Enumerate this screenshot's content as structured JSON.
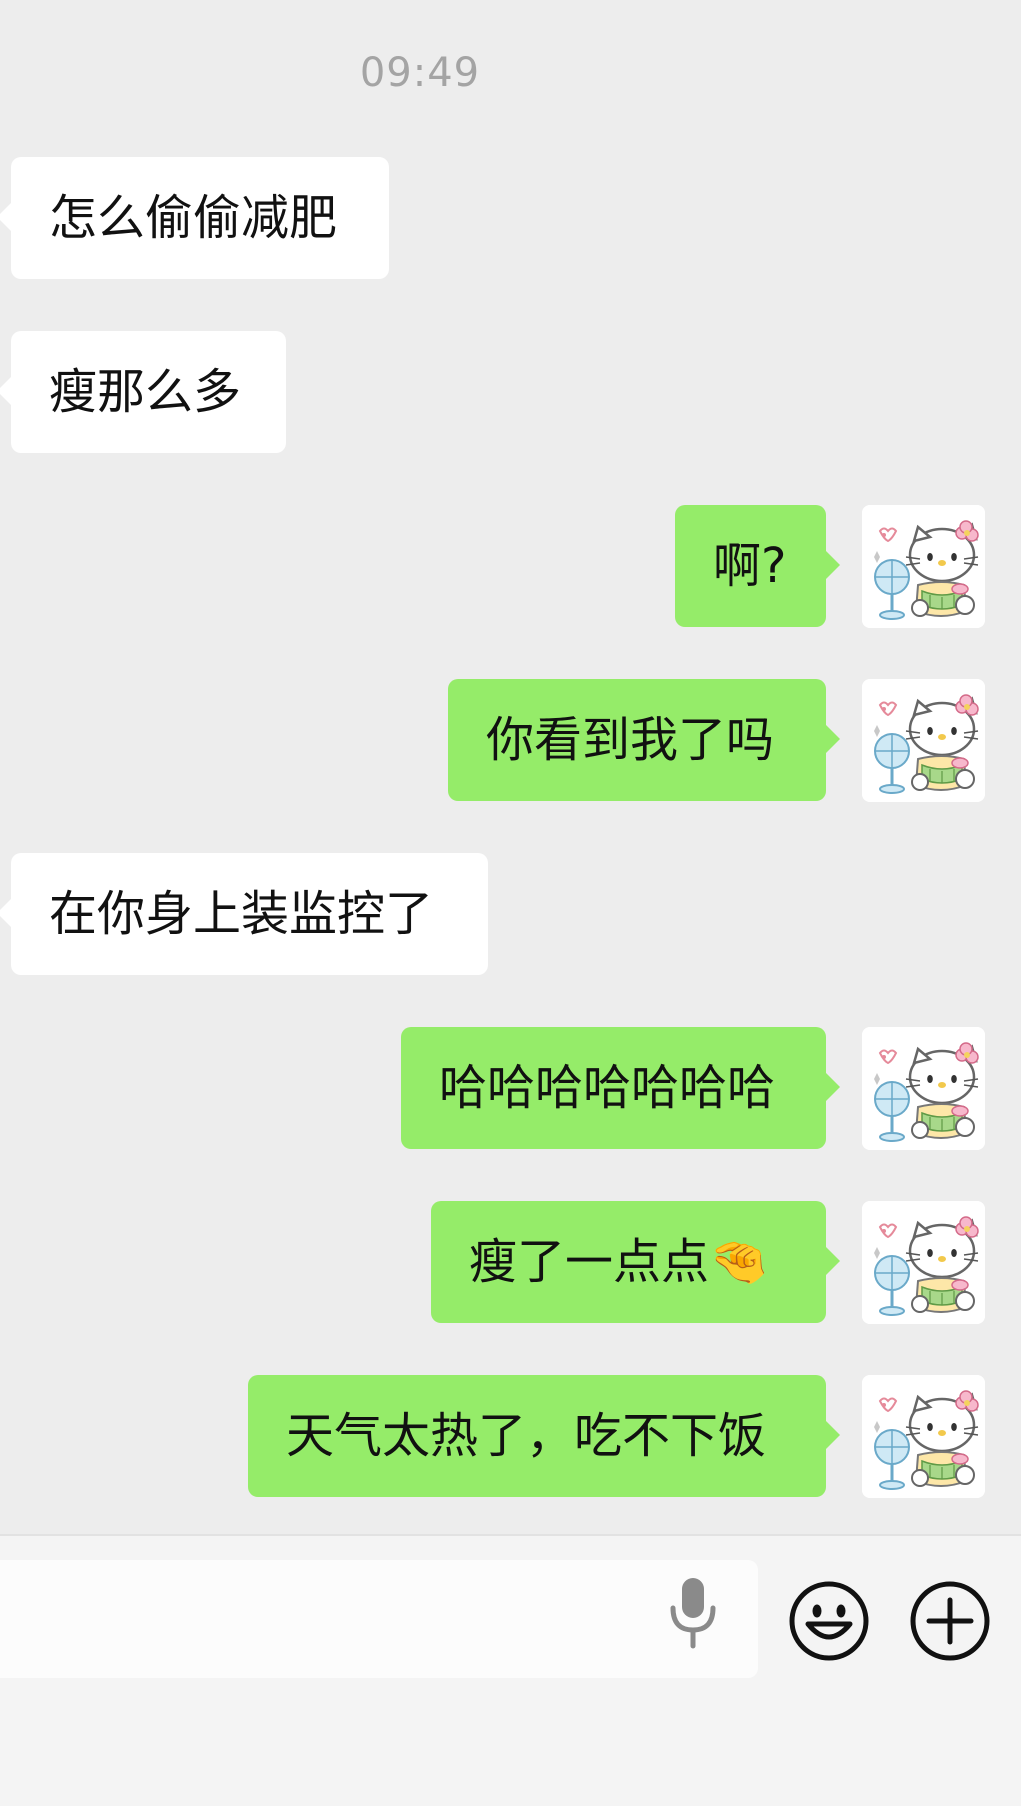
{
  "timestamp": "09:49",
  "messages": [
    {
      "side": "in",
      "text": "怎么偷偷减肥"
    },
    {
      "side": "in",
      "text": "瘦那么多"
    },
    {
      "side": "out",
      "text": "啊?"
    },
    {
      "side": "out",
      "text": "你看到我了吗"
    },
    {
      "side": "in",
      "text": "在你身上装监控了"
    },
    {
      "side": "out",
      "text": "哈哈哈哈哈哈哈"
    },
    {
      "side": "out",
      "text": "瘦了一点点🤏"
    },
    {
      "side": "out",
      "text": "天气太热了，吃不下饭"
    }
  ],
  "avatar_icon": "hello-kitty-fan-sticker",
  "input_bar": {
    "text_field_value": "",
    "voice_icon": "microphone-icon",
    "emoji_icon": "smiley-face-icon",
    "more_icon": "plus-circle-icon"
  },
  "colors": {
    "background": "#ededed",
    "incoming_bubble": "#ffffff",
    "outgoing_bubble": "#95ec69",
    "input_bar": "#f4f4f4"
  }
}
